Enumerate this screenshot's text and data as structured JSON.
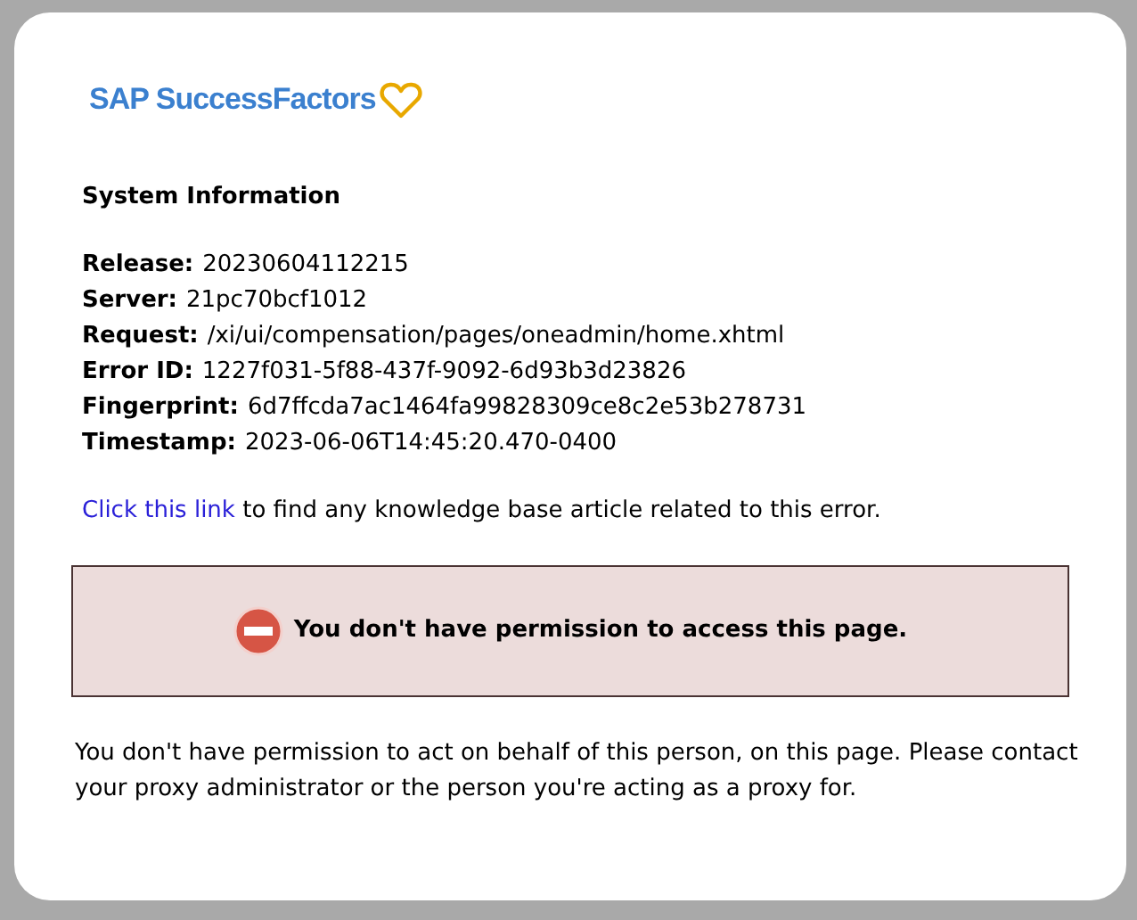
{
  "logo": {
    "text": "SAP SuccessFactors"
  },
  "system_info": {
    "title": "System Information",
    "fields": [
      {
        "label": "Release:",
        "value": "20230604112215"
      },
      {
        "label": "Server:",
        "value": "21pc70bcf1012"
      },
      {
        "label": "Request:",
        "value": "/xi/ui/compensation/pages/oneadmin/home.xhtml"
      },
      {
        "label": "Error ID:",
        "value": "1227f031-5f88-437f-9092-6d93b3d23826"
      },
      {
        "label": "Fingerprint:",
        "value": "6d7ffcda7ac1464fa99828309ce8c2e53b278731"
      },
      {
        "label": "Timestamp:",
        "value": "2023-06-06T14:45:20.470-0400"
      }
    ]
  },
  "help": {
    "link": "Click this link",
    "text": "to find any knowledge base article related to this error."
  },
  "error_banner": {
    "message": "You don't have permission to access this page."
  },
  "details": "You don't have permission to act on behalf of this person, on this page. Please contact your proxy administrator or the person you're acting as a proxy for."
}
